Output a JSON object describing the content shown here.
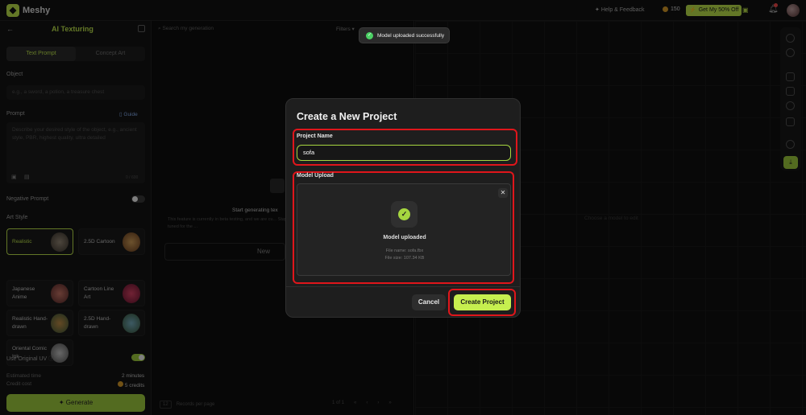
{
  "topbar": {
    "brand": "Meshy",
    "help": "Help & Feedback",
    "credits": "150",
    "promo": "Get My 50% Off"
  },
  "left_panel": {
    "title": "AI Texturing",
    "tabs": [
      "Text Prompt",
      "Concept Art"
    ],
    "object_label": "Object",
    "object_placeholder": "e.g., a sword, a potion, a treasure chest",
    "prompt_label": "Prompt",
    "guide": "Guide",
    "prompt_placeholder": "Describe your desired style of the object, e.g., ancient style, PBR, highest quality, ultra detailed",
    "prompt_count": "0 / 600",
    "negative_prompt": "Negative Prompt",
    "art_style_label": "Art Style",
    "styles": [
      {
        "name": "Realistic",
        "selected": true
      },
      {
        "name": "2.5D Cartoon",
        "selected": false
      },
      {
        "name": "Japanese Anime",
        "selected": false
      },
      {
        "name": "Cartoon Line Art",
        "selected": false
      },
      {
        "name": "Realistic Hand-drawn",
        "selected": false
      },
      {
        "name": "2.5D Hand-drawn",
        "selected": false
      },
      {
        "name": "Oriental Comic Ink",
        "selected": false
      }
    ],
    "original_uv": "Use Original UV",
    "estimated_time_label": "Estimated time",
    "estimated_time_value": "2 minutes",
    "credit_cost_label": "Credit cost",
    "credit_cost_value": "5 credits",
    "generate": "Generate"
  },
  "middle": {
    "search_placeholder": "Search my generation",
    "filters": "Filters",
    "empty_title": "Start generating tex",
    "empty_sub": "This feature is currently in beta testing, and we are cu... Stay tuned for the ...",
    "new_button": "New",
    "per_page": "12",
    "per_page_label": "Records per page",
    "page": "1",
    "page_of": "of 1"
  },
  "viewport": {
    "hint": "Choose a model to edit"
  },
  "toast": {
    "message": "Model uploaded successfully"
  },
  "modal": {
    "title": "Create a New Project",
    "name_label": "Project Name",
    "name_value": "sofa",
    "upload_label": "Model Upload",
    "uploaded_text": "Model uploaded",
    "file_name": "File name: sofa.fbx",
    "file_size": "File size: 107.34 KB",
    "cancel": "Cancel",
    "create": "Create Project",
    "highlight_color": "#e0161b",
    "accent_color": "#c6ef4f"
  }
}
